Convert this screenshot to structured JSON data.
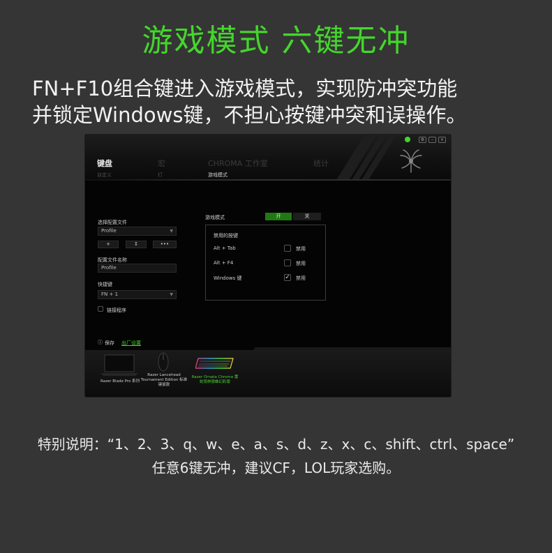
{
  "headline": "游戏模式 六键无冲",
  "intro": {
    "line1": "FN+F10组合键进入游戏模式，实现防冲突功能",
    "line2": "并锁定Windows键，不担心按键冲突和误操作。"
  },
  "note": {
    "line1": "特别说明：“1、2、3、q、w、e、a、s、d、z、x、c、shift、ctrl、space”",
    "line2": "任意6键无冲，建议CF，LOL玩家选购。"
  },
  "app": {
    "tabs": [
      {
        "label": "键盘",
        "active": true
      },
      {
        "label": "宏",
        "active": false
      },
      {
        "label": "CHROMA 工作室",
        "active": false
      },
      {
        "label": "统计",
        "active": false
      }
    ],
    "subtabs": [
      {
        "label": "自定义",
        "active": false
      },
      {
        "label": "灯",
        "active": false
      },
      {
        "label": "游戏模式",
        "active": true
      }
    ],
    "window_controls": [
      "⚙",
      "–",
      "×"
    ],
    "profile": {
      "section_label": "选择配置文件",
      "selected": "Profile",
      "buttons": [
        "+",
        "↕",
        "•••"
      ],
      "name_label": "配置文件名称",
      "name_value": "Profile",
      "shortcut_label": "快捷键",
      "shortcut_value": "FN + 1",
      "link_program_label": "链接程序"
    },
    "game_mode": {
      "label": "游戏模式",
      "on_label": "开",
      "off_label": "关",
      "disabled_keys_title": "禁用的按键",
      "keys": [
        {
          "name": "Alt + Tab",
          "checked": false,
          "option": "禁用"
        },
        {
          "name": "Alt + F4",
          "checked": false,
          "option": "禁用"
        },
        {
          "name": "Windows 键",
          "checked": true,
          "option": "禁用"
        }
      ]
    },
    "footer": {
      "info_label": "保存",
      "link_label": "出厂设置"
    },
    "devices": [
      {
        "name": "Razer Blade Pro 系列",
        "active": false
      },
      {
        "name": "Razer Lancehead Tournament Edition 标准键鼠款",
        "active": false
      },
      {
        "name": "Razer Ornata Chroma 雷蛇雨林狼蛛幻彩版",
        "active": true
      }
    ],
    "accent_color": "#44d62c"
  }
}
